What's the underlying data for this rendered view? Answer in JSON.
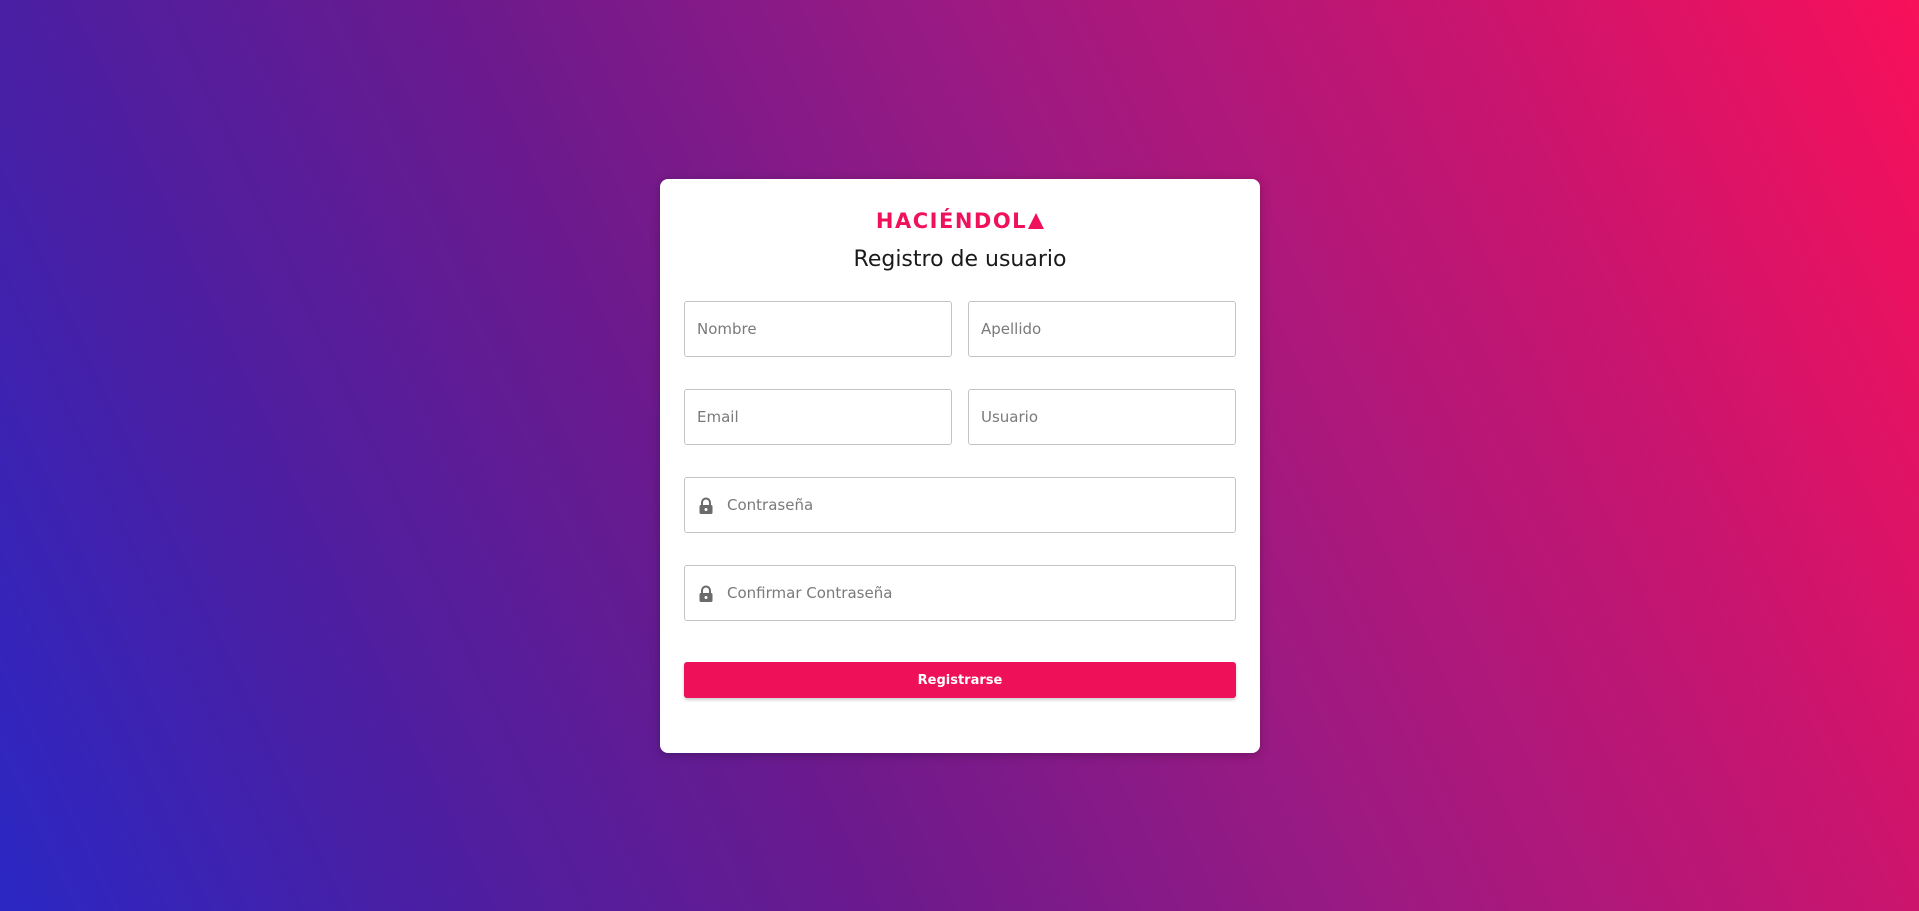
{
  "brand": {
    "logo_text": "HACIÉNDOL",
    "accent_color": "#f0115b"
  },
  "form": {
    "title": "Registro de usuario",
    "fields": {
      "first_name": {
        "placeholder": "Nombre",
        "value": ""
      },
      "last_name": {
        "placeholder": "Apellido",
        "value": ""
      },
      "email": {
        "placeholder": "Email",
        "value": ""
      },
      "username": {
        "placeholder": "Usuario",
        "value": ""
      },
      "password": {
        "placeholder": "Contraseña",
        "value": "",
        "icon": "lock-icon"
      },
      "confirm_password": {
        "placeholder": "Confirmar Contraseña",
        "value": "",
        "icon": "lock-icon"
      }
    },
    "submit_label": "Registrarse"
  }
}
